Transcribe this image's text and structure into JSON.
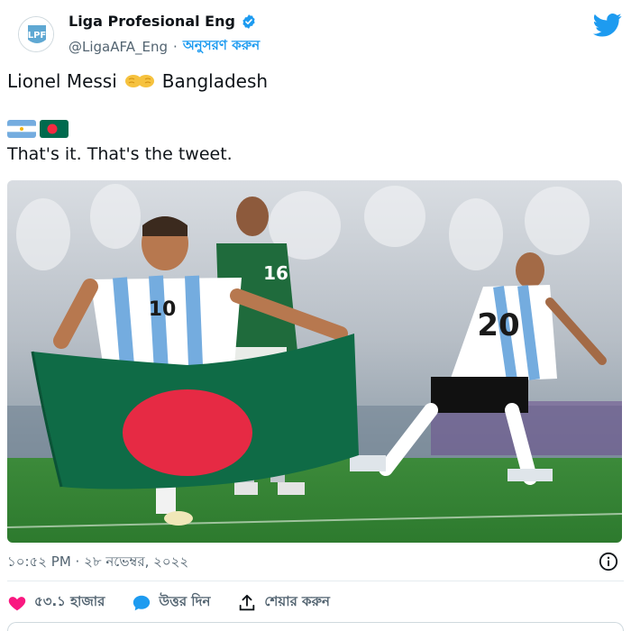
{
  "tweet": {
    "author_name": "Liga Profesional Eng",
    "handle": "@LigaAFA_Eng",
    "separator": "·",
    "follow_label": "অনুসরণ করুন",
    "text_left": "Lionel Messi",
    "text_right": "Bangladesh",
    "line2": "That's it. That's the tweet.",
    "timestamp": "১০:৫২ PM · ২৮ নভেম্বর, ২০২২",
    "likes_label": "৫৩.১ হাজার",
    "reply_label": "উত্তর দিন",
    "share_label": "শেয়ার করুন",
    "player_numbers": [
      "10",
      "16",
      "20"
    ]
  },
  "icons": {
    "verified": "verified-badge-icon",
    "twitter": "twitter-bird-icon",
    "fist": "fist-bump-emoji",
    "info": "info-icon",
    "like": "heart-icon",
    "reply": "reply-bubble-icon",
    "share": "share-icon"
  },
  "colors": {
    "accent": "#1d9bf0",
    "like": "#f91880",
    "bangladesh_green": "#006a4e",
    "bangladesh_red": "#f42a41",
    "argentina_blue": "#74acdf"
  }
}
